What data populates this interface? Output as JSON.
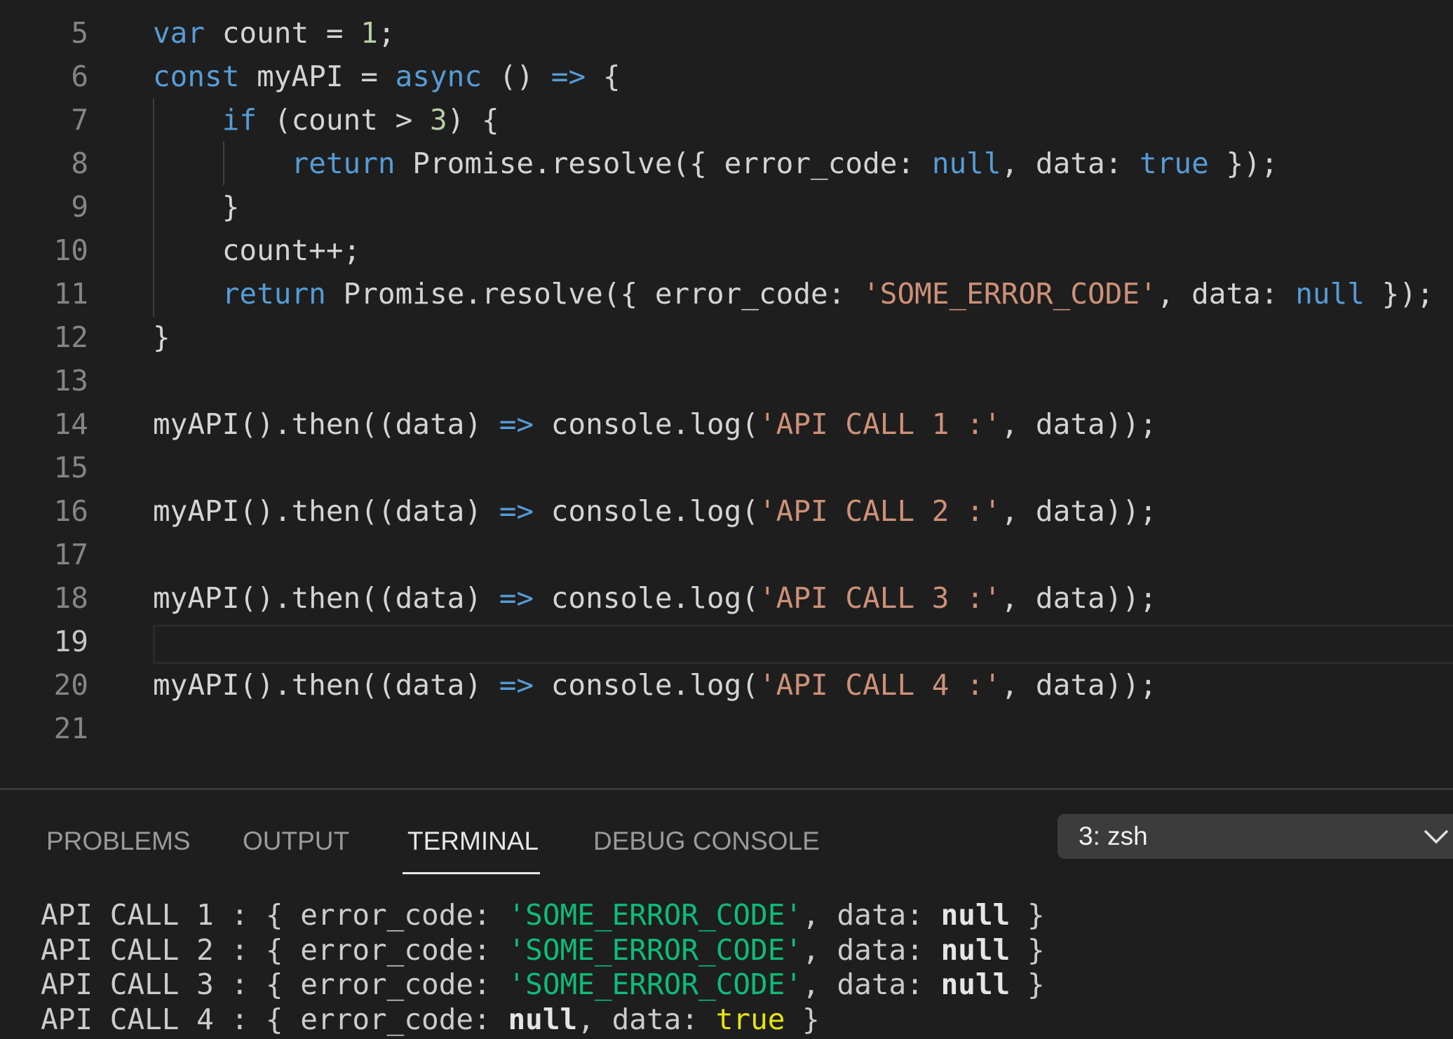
{
  "colors": {
    "background": "#1e1e1e",
    "keyword": "#569cd6",
    "number": "#b5cea8",
    "string": "#ce9178",
    "plain": "#d4d4d4",
    "line_number": "#858585",
    "terminal_string": "#0dbc79",
    "terminal_true": "#e5e510"
  },
  "editor": {
    "current_line": "19",
    "lines": [
      {
        "number": "5",
        "tokens": [
          {
            "t": "kw",
            "v": "var"
          },
          {
            "t": "plain",
            "v": " count = "
          },
          {
            "t": "num",
            "v": "1"
          },
          {
            "t": "plain",
            "v": ";"
          }
        ]
      },
      {
        "number": "6",
        "tokens": [
          {
            "t": "kw",
            "v": "const"
          },
          {
            "t": "plain",
            "v": " myAPI = "
          },
          {
            "t": "kw",
            "v": "async"
          },
          {
            "t": "plain",
            "v": " () "
          },
          {
            "t": "kw",
            "v": "=>"
          },
          {
            "t": "plain",
            "v": " {"
          }
        ]
      },
      {
        "number": "7",
        "tokens": [
          {
            "t": "plain",
            "v": "    "
          },
          {
            "t": "kw",
            "v": "if"
          },
          {
            "t": "plain",
            "v": " (count > "
          },
          {
            "t": "num",
            "v": "3"
          },
          {
            "t": "plain",
            "v": ") {"
          }
        ]
      },
      {
        "number": "8",
        "tokens": [
          {
            "t": "plain",
            "v": "        "
          },
          {
            "t": "kw",
            "v": "return"
          },
          {
            "t": "plain",
            "v": " Promise.resolve({ error_code: "
          },
          {
            "t": "kw",
            "v": "null"
          },
          {
            "t": "plain",
            "v": ", data: "
          },
          {
            "t": "kw",
            "v": "true"
          },
          {
            "t": "plain",
            "v": " });"
          }
        ]
      },
      {
        "number": "9",
        "tokens": [
          {
            "t": "plain",
            "v": "    }"
          }
        ]
      },
      {
        "number": "10",
        "tokens": [
          {
            "t": "plain",
            "v": "    count++;"
          }
        ]
      },
      {
        "number": "11",
        "tokens": [
          {
            "t": "plain",
            "v": "    "
          },
          {
            "t": "kw",
            "v": "return"
          },
          {
            "t": "plain",
            "v": " Promise.resolve({ error_code: "
          },
          {
            "t": "str",
            "v": "'SOME_ERROR_CODE'"
          },
          {
            "t": "plain",
            "v": ", data: "
          },
          {
            "t": "kw",
            "v": "null"
          },
          {
            "t": "plain",
            "v": " });"
          }
        ]
      },
      {
        "number": "12",
        "tokens": [
          {
            "t": "plain",
            "v": "}"
          }
        ]
      },
      {
        "number": "13",
        "tokens": []
      },
      {
        "number": "14",
        "tokens": [
          {
            "t": "plain",
            "v": "myAPI().then((data) "
          },
          {
            "t": "kw",
            "v": "=>"
          },
          {
            "t": "plain",
            "v": " console.log("
          },
          {
            "t": "str",
            "v": "'API CALL 1 :'"
          },
          {
            "t": "plain",
            "v": ", data));"
          }
        ]
      },
      {
        "number": "15",
        "tokens": []
      },
      {
        "number": "16",
        "tokens": [
          {
            "t": "plain",
            "v": "myAPI().then((data) "
          },
          {
            "t": "kw",
            "v": "=>"
          },
          {
            "t": "plain",
            "v": " console.log("
          },
          {
            "t": "str",
            "v": "'API CALL 2 :'"
          },
          {
            "t": "plain",
            "v": ", data));"
          }
        ]
      },
      {
        "number": "17",
        "tokens": []
      },
      {
        "number": "18",
        "tokens": [
          {
            "t": "plain",
            "v": "myAPI().then((data) "
          },
          {
            "t": "kw",
            "v": "=>"
          },
          {
            "t": "plain",
            "v": " console.log("
          },
          {
            "t": "str",
            "v": "'API CALL 3 :'"
          },
          {
            "t": "plain",
            "v": ", data));"
          }
        ]
      },
      {
        "number": "19",
        "tokens": []
      },
      {
        "number": "20",
        "tokens": [
          {
            "t": "plain",
            "v": "myAPI().then((data) "
          },
          {
            "t": "kw",
            "v": "=>"
          },
          {
            "t": "plain",
            "v": " console.log("
          },
          {
            "t": "str",
            "v": "'API CALL 4 :'"
          },
          {
            "t": "plain",
            "v": ", data));"
          }
        ]
      },
      {
        "number": "21",
        "tokens": []
      }
    ]
  },
  "panel": {
    "tabs": {
      "problems": "PROBLEMS",
      "output": "OUTPUT",
      "terminal": "TERMINAL",
      "debug_console": "DEBUG CONSOLE"
    },
    "active_tab": "TERMINAL",
    "terminal_selector": {
      "value": "3: zsh",
      "icon": "chevron-down-icon"
    },
    "terminal_lines": [
      [
        {
          "t": "plain",
          "v": "API CALL 1 : { error_code: "
        },
        {
          "t": "str",
          "v": "'SOME_ERROR_CODE'"
        },
        {
          "t": "plain",
          "v": ", data: "
        },
        {
          "t": "null",
          "v": "null"
        },
        {
          "t": "plain",
          "v": " }"
        }
      ],
      [
        {
          "t": "plain",
          "v": "API CALL 2 : { error_code: "
        },
        {
          "t": "str",
          "v": "'SOME_ERROR_CODE'"
        },
        {
          "t": "plain",
          "v": ", data: "
        },
        {
          "t": "null",
          "v": "null"
        },
        {
          "t": "plain",
          "v": " }"
        }
      ],
      [
        {
          "t": "plain",
          "v": "API CALL 3 : { error_code: "
        },
        {
          "t": "str",
          "v": "'SOME_ERROR_CODE'"
        },
        {
          "t": "plain",
          "v": ", data: "
        },
        {
          "t": "null",
          "v": "null"
        },
        {
          "t": "plain",
          "v": " }"
        }
      ],
      [
        {
          "t": "plain",
          "v": "API CALL 4 : { error_code: "
        },
        {
          "t": "null",
          "v": "null"
        },
        {
          "t": "plain",
          "v": ", data: "
        },
        {
          "t": "true",
          "v": "true"
        },
        {
          "t": "plain",
          "v": " }"
        }
      ]
    ]
  }
}
